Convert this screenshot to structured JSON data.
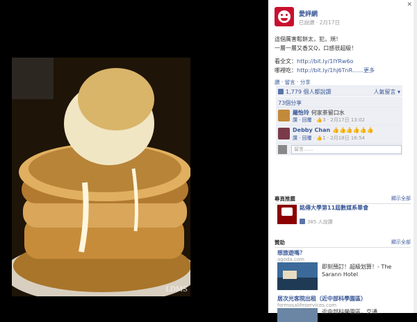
{
  "post": {
    "page_name": "愛評網",
    "audience": "已說讚",
    "date": "2月17日",
    "line1": "這個厲害鬆餅太，犯，規！",
    "line2": "一層一層又香又Q，口感很超級！",
    "full_label": "看全文：",
    "full_link": "http://bit.ly/1lYRw6o",
    "map_label": "哪裡吃：",
    "map_link": "http://bit.ly/1hj6TnR",
    "more": "……更多"
  },
  "actions": "讚 · 留言 · 分享",
  "likes": {
    "count": "1,779 個人都說讚",
    "sort": "人氣留言 ▾"
  },
  "shares": "73個分享",
  "comments": [
    {
      "name": "羅怡玲",
      "text": "何家茶留口水",
      "actions": "讚 · 回覆",
      "likes": "3",
      "time": "2月17日 13:02",
      "avatar_color": "#c28a3a"
    },
    {
      "name": "Debby Chan",
      "text": "👍👍👍👍👍👍",
      "actions": "讚 · 回覆",
      "likes": "1",
      "time": "2月18日 16:54",
      "avatar_color": "#7a3a4a"
    }
  ],
  "reply_placeholder": "留言……",
  "suggested": {
    "heading": "專頁推薦",
    "see_all": "顯示全部",
    "name": "銘傳大學第11屆數媒系畢會",
    "likes": "385 人說讚"
  },
  "sponsored": {
    "heading": "贊助",
    "see_all": "顯示全部",
    "ad1": {
      "title": "想旅遊嗎？",
      "host": "agoda.com",
      "text": "即刻預訂！超級划算！- The Sarann Hotel"
    },
    "ad2": {
      "title": "居次光客院出租（近中部科學園區）",
      "host": "formosalifeservices.com",
      "text": "近中部科學園區，交通..."
    }
  },
  "watermark": "LDMS"
}
